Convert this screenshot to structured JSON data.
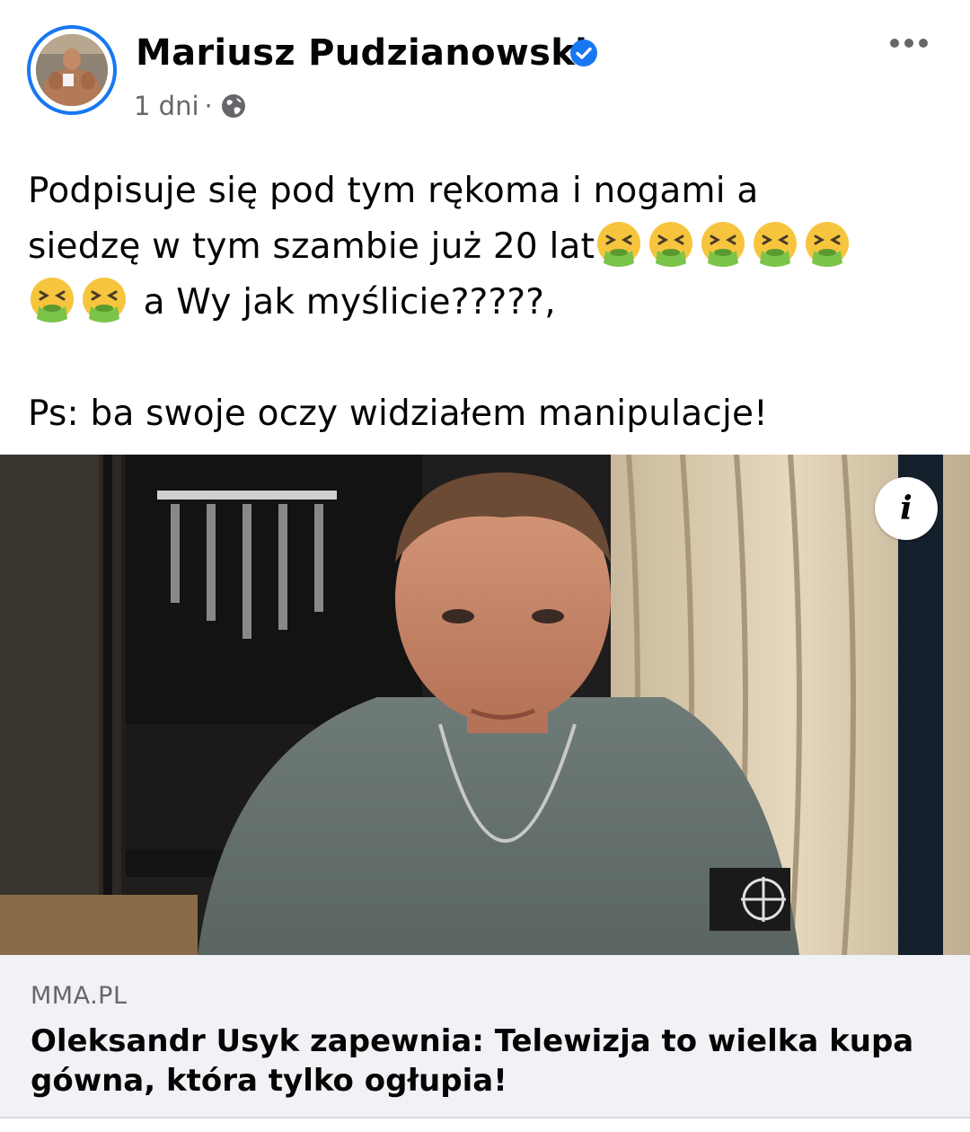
{
  "post": {
    "author": "Mariusz Pudzianowski",
    "timestamp": "1 dni",
    "separator": "·",
    "privacy_icon": "globe-icon",
    "more_icon": "more-options-icon",
    "verified_icon": "verified-badge-icon",
    "text_line1": "Podpisuje się pod tym rękoma i nogami a",
    "text_line2_prefix": "siedzę w tym szambie już 20 lat",
    "text_line3_suffix": " a Wy jak myślicie?????,",
    "text_ps": "Ps: ba swoje oczy widziałem manipulacje!",
    "emoji_name": "face-vomiting-emoji"
  },
  "link": {
    "domain": "MMA.PL",
    "headline": "Oleksandr Usyk zapewnia: Telewizja to wielka kupa gówna, która tylko ogłupia!",
    "info_label": "i",
    "info_icon": "info-icon"
  },
  "colors": {
    "accent": "#1877f2",
    "text_primary": "#050505",
    "text_secondary": "#65676b",
    "card_background": "#f0f2f5"
  }
}
